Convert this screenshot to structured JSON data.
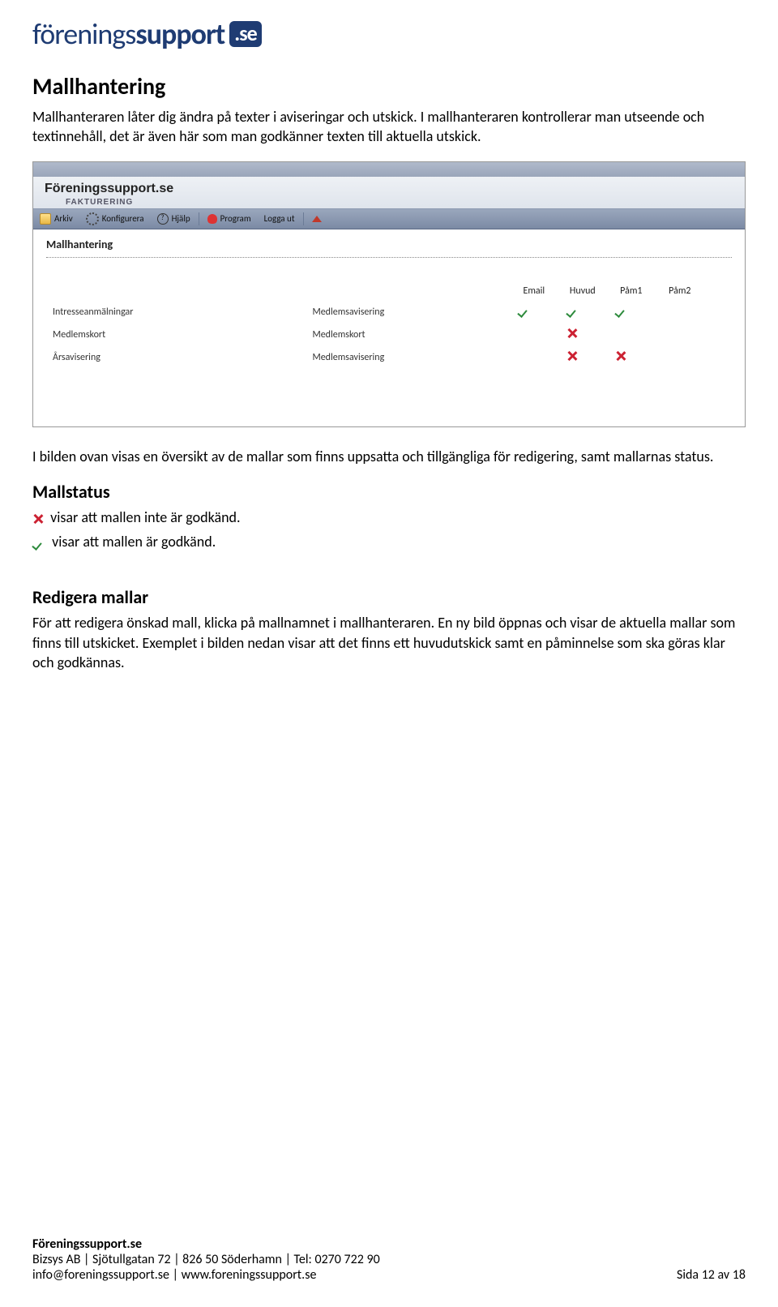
{
  "logo": {
    "part1": "förenings",
    "part2": "support",
    "badge": ".se"
  },
  "h1": "Mallhantering",
  "intro": "Mallhanteraren låter dig ändra på texter i aviseringar och utskick. I mallhanteraren kontrollerar man utseende och textinnehåll, det är även här som man godkänner texten till aktuella utskick.",
  "screenshot": {
    "brand": "Föreningssupport.se",
    "sub": "FAKTURERING",
    "toolbar": {
      "arkiv": "Arkiv",
      "konfigurera": "Konfigurera",
      "hjalp": "Hjälp",
      "program": "Program",
      "loggaut": "Logga ut"
    },
    "title": "Mallhantering",
    "cols": {
      "email": "Email",
      "huvud": "Huvud",
      "pam1": "Påm1",
      "pam2": "Påm2"
    },
    "rows": [
      {
        "left": "Intresseanmälningar",
        "mid": "Medlemsavisering",
        "icons": [
          "tick",
          "tick",
          "tick",
          ""
        ]
      },
      {
        "left": "Medlemskort",
        "mid": "Medlemskort",
        "icons": [
          "",
          "cross",
          "",
          ""
        ]
      },
      {
        "left": "Årsavisering",
        "mid": "Medlemsavisering",
        "icons": [
          "",
          "cross",
          "cross",
          ""
        ]
      }
    ]
  },
  "afterImg": "I bilden ovan visas en översikt av de mallar som finns uppsatta och tillgängliga för redigering, samt mallarnas status.",
  "h2a": "Mallstatus",
  "statusCross": " visar att mallen inte är godkänd.",
  "statusTick": " visar att mallen är godkänd.",
  "h2b": "Redigera mallar",
  "redigera": "För att redigera önskad mall, klicka på mallnamnet i mallhanteraren. En ny bild öppnas och visar de aktuella mallar som finns till utskicket. Exemplet i bilden nedan visar att det finns ett huvudutskick samt en påminnelse som ska göras klar och godkännas.",
  "footer": {
    "name": "Föreningssupport.se",
    "addr": "Bizsys AB   |   Sjötullgatan 72   |   826 50 Söderhamn   |   Tel: 0270 722 90",
    "email": "info@foreningssupport.se   |   www.foreningssupport.se",
    "page": "Sida 12 av 18"
  }
}
